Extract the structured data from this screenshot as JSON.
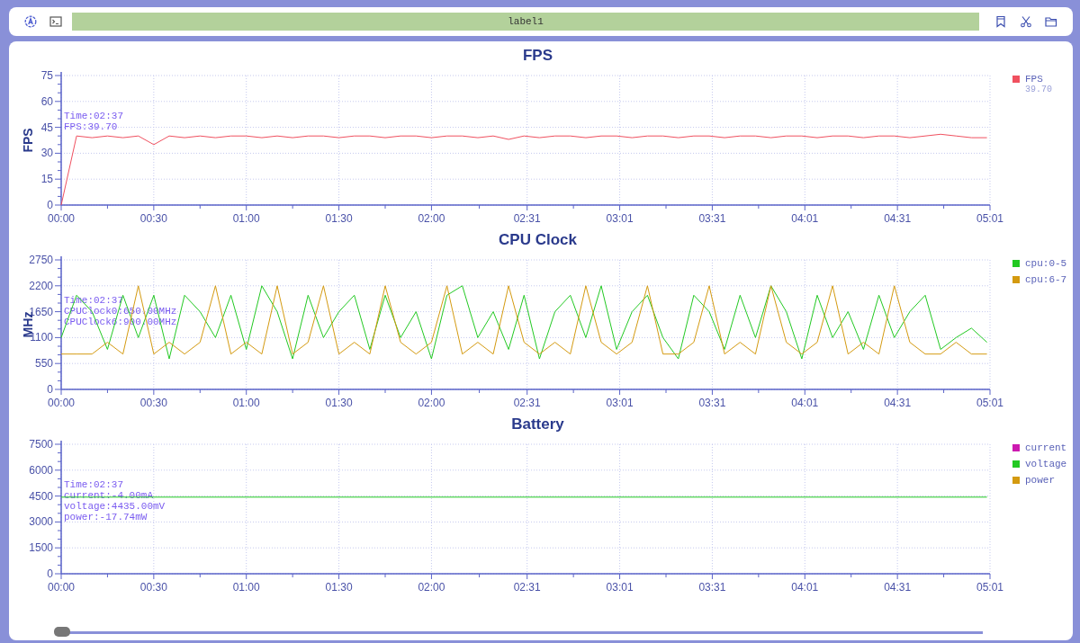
{
  "toolbar": {
    "label": "label1"
  },
  "charts": [
    {
      "legend_values": [
        "39.70"
      ],
      "tooltip": [
        "Time:02:37",
        "FPS:39.70"
      ],
      "chart_data": {
        "type": "line",
        "title": "FPS",
        "ylabel": "FPS",
        "grid": true,
        "x": [
          0,
          5,
          10,
          15,
          20,
          25,
          30,
          35,
          40,
          45,
          50,
          55,
          60,
          65,
          70,
          75,
          80,
          85,
          90,
          95,
          100,
          105,
          110,
          115,
          120,
          125,
          130,
          135,
          140,
          145,
          150,
          155,
          160,
          165,
          170,
          175,
          180,
          185,
          190,
          195,
          200,
          205,
          210,
          215,
          220,
          225,
          230,
          235,
          240,
          245,
          250,
          255,
          260,
          265,
          270,
          275,
          280,
          285,
          290,
          295,
          300
        ],
        "series": [
          {
            "name": "FPS",
            "color": "#f0505f",
            "values": [
              0,
              40,
              39,
              40,
              39,
              40,
              35,
              40,
              39,
              40,
              39,
              40,
              40,
              39,
              40,
              39,
              40,
              40,
              39,
              40,
              40,
              39,
              40,
              40,
              39,
              40,
              40,
              39,
              40,
              38,
              40,
              39,
              40,
              40,
              39,
              40,
              40,
              39,
              40,
              40,
              39,
              40,
              40,
              39,
              40,
              40,
              39,
              40,
              40,
              39,
              40,
              40,
              39,
              40,
              40,
              39,
              40,
              41,
              40,
              39,
              39
            ]
          }
        ],
        "xlim": [
          0,
          301
        ],
        "ylim": [
          0,
          75
        ],
        "yticks": [
          0,
          15,
          30,
          45,
          60,
          75
        ],
        "xticks": [
          {
            "value": 0,
            "label": "00:00"
          },
          {
            "value": 30,
            "label": "00:30"
          },
          {
            "value": 60,
            "label": "01:00"
          },
          {
            "value": 90,
            "label": "01:30"
          },
          {
            "value": 120,
            "label": "02:00"
          },
          {
            "value": 151,
            "label": "02:31"
          },
          {
            "value": 181,
            "label": "03:01"
          },
          {
            "value": 211,
            "label": "03:31"
          },
          {
            "value": 241,
            "label": "04:01"
          },
          {
            "value": 271,
            "label": "04:31"
          },
          {
            "value": 301,
            "label": "05:01"
          }
        ]
      }
    },
    {
      "tooltip": [
        "Time:02:37",
        "CPUClock0:650.00MHz",
        "CPUClock6:900.00MHz"
      ],
      "chart_data": {
        "type": "line",
        "title": "CPU Clock",
        "ylabel": "MHz",
        "grid": true,
        "x": [
          0,
          5,
          10,
          15,
          20,
          25,
          30,
          35,
          40,
          45,
          50,
          55,
          60,
          65,
          70,
          75,
          80,
          85,
          90,
          95,
          100,
          105,
          110,
          115,
          120,
          125,
          130,
          135,
          140,
          145,
          150,
          155,
          160,
          165,
          170,
          175,
          180,
          185,
          190,
          195,
          200,
          205,
          210,
          215,
          220,
          225,
          230,
          235,
          240,
          245,
          250,
          255,
          260,
          265,
          270,
          275,
          280,
          285,
          290,
          295,
          300
        ],
        "series": [
          {
            "name": "cpu:0-5",
            "color": "#22c922",
            "values": [
              1100,
              2000,
              1650,
              850,
              2000,
              1100,
              2000,
              650,
              2000,
              1650,
              1100,
              2000,
              850,
              2200,
              1650,
              650,
              2000,
              1100,
              1650,
              2000,
              850,
              2000,
              1100,
              1650,
              650,
              2000,
              2200,
              1100,
              1650,
              850,
              2000,
              650,
              1650,
              2000,
              1100,
              2200,
              850,
              1650,
              2000,
              1100,
              650,
              2000,
              1650,
              850,
              2000,
              1100,
              2200,
              1650,
              650,
              2000,
              1100,
              1650,
              850,
              2000,
              1100,
              1650,
              2000,
              850,
              1100,
              1300,
              1000
            ]
          },
          {
            "name": "cpu:6-7",
            "color": "#d49a10",
            "values": [
              750,
              750,
              750,
              1000,
              750,
              2200,
              750,
              1000,
              750,
              1000,
              2200,
              750,
              1000,
              750,
              2200,
              750,
              1000,
              2200,
              750,
              1000,
              750,
              2200,
              1000,
              750,
              1000,
              2200,
              750,
              1000,
              750,
              2200,
              1000,
              750,
              1000,
              750,
              2200,
              1000,
              750,
              1000,
              2200,
              750,
              750,
              1000,
              2200,
              750,
              1000,
              750,
              2200,
              1000,
              750,
              1000,
              2200,
              750,
              1000,
              750,
              2200,
              1000,
              750,
              750,
              1000,
              750,
              750
            ]
          }
        ],
        "xlim": [
          0,
          301
        ],
        "ylim": [
          0,
          2750
        ],
        "yticks": [
          0,
          550,
          1100,
          1650,
          2200,
          2750
        ],
        "xticks": [
          {
            "value": 0,
            "label": "00:00"
          },
          {
            "value": 30,
            "label": "00:30"
          },
          {
            "value": 60,
            "label": "01:00"
          },
          {
            "value": 90,
            "label": "01:30"
          },
          {
            "value": 120,
            "label": "02:00"
          },
          {
            "value": 151,
            "label": "02:31"
          },
          {
            "value": 181,
            "label": "03:01"
          },
          {
            "value": 211,
            "label": "03:31"
          },
          {
            "value": 241,
            "label": "04:01"
          },
          {
            "value": 271,
            "label": "04:31"
          },
          {
            "value": 301,
            "label": "05:01"
          }
        ]
      }
    },
    {
      "tooltip": [
        "Time:02:37",
        "current:-4.00mA",
        "voltage:4435.00mV",
        "power:-17.74mW"
      ],
      "chart_data": {
        "type": "line",
        "title": "Battery",
        "x": [
          0,
          300
        ],
        "grid": true,
        "series": [
          {
            "name": "current",
            "color": "#cc1ab0",
            "values": [
              null,
              null
            ]
          },
          {
            "name": "voltage",
            "color": "#22c922",
            "values": [
              4435,
              4435
            ]
          },
          {
            "name": "power",
            "color": "#d49a10",
            "values": [
              null,
              null
            ]
          }
        ],
        "xlim": [
          0,
          301
        ],
        "ylim": [
          0,
          7500
        ],
        "yticks": [
          0,
          1500,
          3000,
          4500,
          6000,
          7500
        ],
        "xticks": [
          {
            "value": 0,
            "label": "00:00"
          },
          {
            "value": 30,
            "label": "00:30"
          },
          {
            "value": 60,
            "label": "01:00"
          },
          {
            "value": 90,
            "label": "01:30"
          },
          {
            "value": 120,
            "label": "02:00"
          },
          {
            "value": 151,
            "label": "02:31"
          },
          {
            "value": 181,
            "label": "03:01"
          },
          {
            "value": 211,
            "label": "03:31"
          },
          {
            "value": 241,
            "label": "04:01"
          },
          {
            "value": 271,
            "label": "04:31"
          },
          {
            "value": 301,
            "label": "05:01"
          }
        ]
      }
    }
  ],
  "slider": {
    "level": 0
  }
}
